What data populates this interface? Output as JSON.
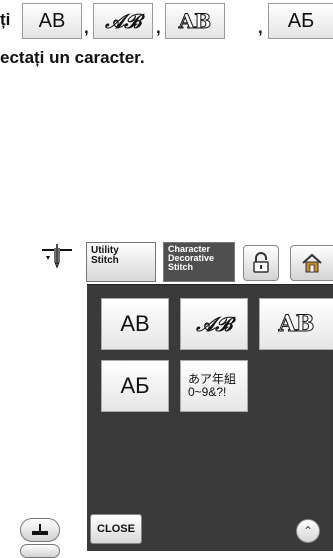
{
  "instruction": {
    "line1_prefix": "ți",
    "separator": ",",
    "line2": "ectați un caracter."
  },
  "font_chips": [
    {
      "label": "AB"
    },
    {
      "label": "𝒜ℬ"
    },
    {
      "label": "AB"
    },
    {
      "label": "АБ"
    }
  ],
  "tabs": {
    "utility": "Utility\nStitch",
    "utility_line1": "Utility",
    "utility_line2": "Stitch",
    "character_line1": "Character",
    "character_line2": "Decorative",
    "character_line3": "Stitch"
  },
  "char_buttons": {
    "ab": "AB",
    "script": "𝒜ℬ",
    "outline": "AB",
    "cyrillic": "АБ",
    "jp_line1": "あア年組",
    "jp_line2": "0~9&?!"
  },
  "close_label": "CLOSE",
  "icons": {
    "needle": "needle-position-icon",
    "lock": "lock-icon",
    "home": "home-icon",
    "scroll": "double-chevron-up-icon",
    "presser": "presser-foot-icon"
  },
  "colors": {
    "panel": "#3a3a3a",
    "selected_tab": "#4f4f4f"
  }
}
